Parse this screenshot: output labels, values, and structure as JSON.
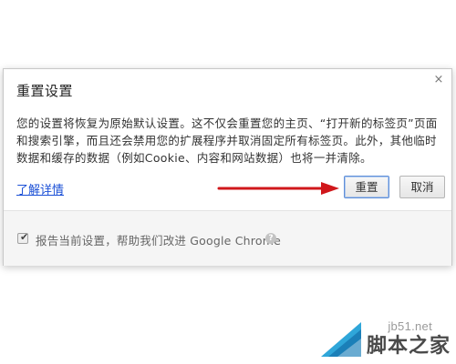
{
  "dialog": {
    "title": "重置设置",
    "close_symbol": "×",
    "description": "您的设置将恢复为原始默认设置。这不仅会重置您的主页、“打开新的标签页”页面和搜索引擎，而且还会禁用您的扩展程序并取消固定所有标签页。此外，其他临时数据和缓存的数据（例如Cookie、内容和网站数据）也将一并清除。",
    "learn_more": "了解详情",
    "reset_button": "重置",
    "cancel_button": "取消",
    "report_checkbox": {
      "checked": true,
      "label": "报告当前设置，帮助我们改进 Google Chrome"
    },
    "help_symbol": "?"
  },
  "annotation": {
    "arrow_color": "#d0171b",
    "points_to": "reset-button"
  },
  "watermark": {
    "domain": "jb51.net",
    "name": "脚本之家"
  },
  "colors": {
    "link": "#1a4fd6",
    "focus_border": "#5f8fd8",
    "footer_bg": "#f5f5f5"
  }
}
